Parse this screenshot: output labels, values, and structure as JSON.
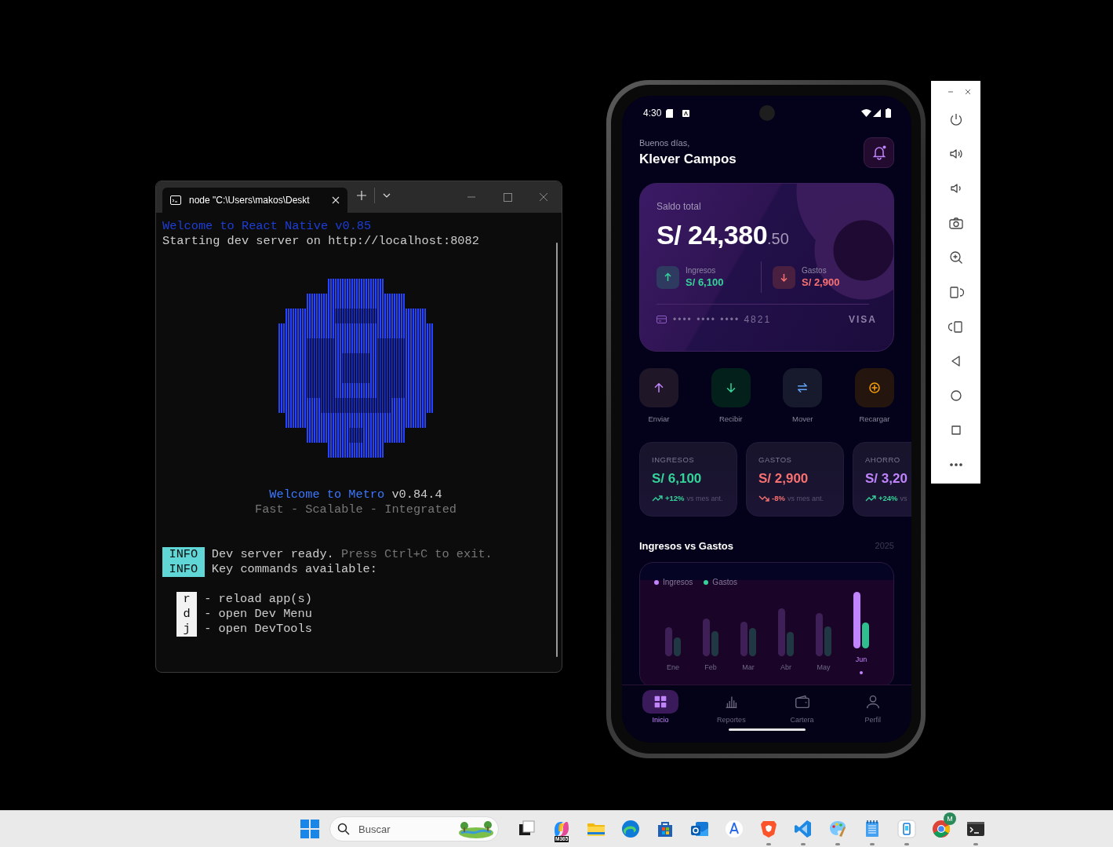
{
  "terminal": {
    "tab_title": "node \"C:\\Users\\makos\\Deskt",
    "header": [
      {
        "kind": "blue",
        "text": "Welcome to React Native v0.85"
      },
      {
        "kind": "normal",
        "text": "Starting dev server on http://localhost:8082"
      }
    ],
    "metro_title": [
      {
        "kind": "bright-blue",
        "text": "Welcome to Metro"
      },
      {
        "kind": "normal",
        "text": "v0.84.4"
      }
    ],
    "metro_tagline": {
      "kind": "dim",
      "text": "Fast - Scalable - Integrated"
    },
    "info": [
      {
        "tag": "INFO",
        "segments": [
          {
            "kind": "normal",
            "text": "Dev server ready."
          },
          {
            "kind": "dim",
            "text": "Press Ctrl+C to exit."
          }
        ]
      },
      {
        "tag": "INFO",
        "segments": [
          {
            "kind": "normal",
            "text": "Key commands available:"
          }
        ]
      }
    ],
    "keys": [
      {
        "key": "r",
        "text": "- reload app(s)"
      },
      {
        "key": "d",
        "text": "- open Dev Menu"
      },
      {
        "key": "j",
        "text": "- open DevTools"
      }
    ]
  },
  "phone": {
    "status_bar": {
      "time": "4:30"
    },
    "greeting": "Buenos días,",
    "user_name": "Klever Campos",
    "notifications": {
      "unread": true
    },
    "balance_card": {
      "label": "Saldo total",
      "amount": "S/ 24,380",
      "cents": ".50",
      "income": {
        "label": "Ingresos",
        "value": "S/ 6,100"
      },
      "expense": {
        "label": "Gastos",
        "value": "S/ 2,900"
      },
      "card_number": "•••• •••• •••• 4821",
      "brand": "VISA"
    },
    "actions": [
      {
        "kind": "send",
        "label": "Enviar"
      },
      {
        "kind": "receive",
        "label": "Recibir"
      },
      {
        "kind": "transfer",
        "label": "Mover"
      },
      {
        "kind": "topup",
        "label": "Recargar"
      }
    ],
    "stats": [
      {
        "label": "INGRESOS",
        "value": "S/ 6,100",
        "kind": "up",
        "trend": "+12%",
        "note": "vs mes ant.",
        "color": "#34d399"
      },
      {
        "label": "GASTOS",
        "value": "S/ 2,900",
        "kind": "down",
        "trend": "-8%",
        "note": "vs mes ant.",
        "color": "#f87171"
      },
      {
        "label": "AHORRO",
        "value": "S/ 3,20",
        "kind": "up",
        "trend": "+24%",
        "note": "vs",
        "color": "#c084fc"
      }
    ],
    "chart": {
      "title": "Ingresos vs Gastos",
      "year": "2025",
      "legend": [
        {
          "label": "Ingresos",
          "color": "#c084fc"
        },
        {
          "label": "Gastos",
          "color": "#34d399"
        }
      ],
      "months": [
        {
          "label": "Ene",
          "selected": false
        },
        {
          "label": "Feb",
          "selected": false
        },
        {
          "label": "Mar",
          "selected": false
        },
        {
          "label": "Abr",
          "selected": false
        },
        {
          "label": "May",
          "selected": false
        },
        {
          "label": "Jun",
          "selected": true
        }
      ]
    },
    "nav": [
      {
        "kind": "home",
        "label": "Inicio",
        "selected": true
      },
      {
        "kind": "reports",
        "label": "Reportes",
        "selected": false
      },
      {
        "kind": "wallet",
        "label": "Cartera",
        "selected": false
      },
      {
        "kind": "profile",
        "label": "Perfil",
        "selected": false
      }
    ]
  },
  "taskbar": {
    "search": {
      "placeholder": "Buscar"
    },
    "apps": [
      {
        "kind": "task-view",
        "running": false
      },
      {
        "kind": "copilot",
        "badge": "M365",
        "running": false
      },
      {
        "kind": "explorer",
        "running": false
      },
      {
        "kind": "edge",
        "running": false
      },
      {
        "kind": "store",
        "running": false
      },
      {
        "kind": "outlook",
        "running": false
      },
      {
        "kind": "compass",
        "running": false
      },
      {
        "kind": "brave",
        "running": true
      },
      {
        "kind": "vscode",
        "running": true
      },
      {
        "kind": "paint",
        "running": true
      },
      {
        "kind": "notepad",
        "running": true
      },
      {
        "kind": "phone-link",
        "running": true
      },
      {
        "kind": "chrome",
        "badge": "M",
        "running": false
      },
      {
        "kind": "terminal",
        "running": true
      }
    ]
  }
}
